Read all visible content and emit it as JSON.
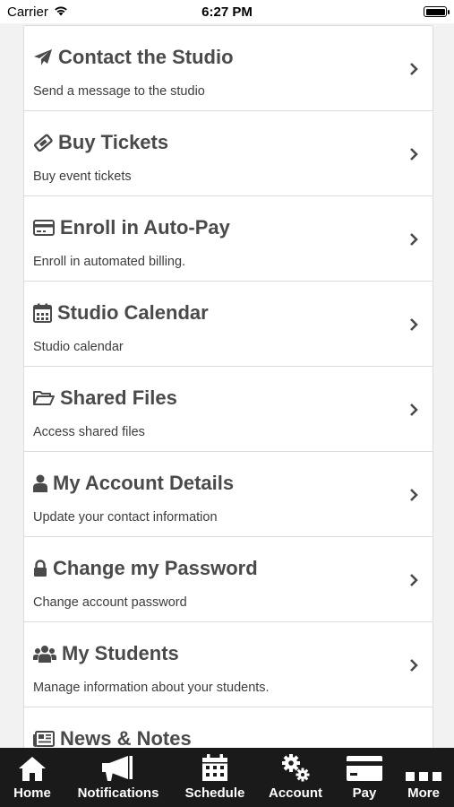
{
  "status": {
    "carrier": "Carrier",
    "time": "6:27 PM"
  },
  "menu": [
    {
      "title": "Contact the Studio",
      "subtitle": "Send a message to the studio",
      "icon": "paper-plane-icon"
    },
    {
      "title": "Buy Tickets",
      "subtitle": "Buy event tickets",
      "icon": "ticket-icon"
    },
    {
      "title": "Enroll in Auto-Pay",
      "subtitle": "Enroll in automated billing.",
      "icon": "credit-card-icon"
    },
    {
      "title": "Studio Calendar",
      "subtitle": "Studio calendar",
      "icon": "calendar-icon"
    },
    {
      "title": "Shared Files",
      "subtitle": "Access shared files",
      "icon": "folder-open-icon"
    },
    {
      "title": "My Account Details",
      "subtitle": "Update your contact information",
      "icon": "user-icon"
    },
    {
      "title": "Change my Password",
      "subtitle": "Change account password",
      "icon": "lock-icon"
    },
    {
      "title": "My Students",
      "subtitle": "Manage information about your students.",
      "icon": "users-icon"
    },
    {
      "title": "News & Notes",
      "subtitle": "",
      "icon": "newspaper-icon"
    }
  ],
  "tabs": [
    {
      "label": "Home",
      "icon": "home-icon"
    },
    {
      "label": "Notifications",
      "icon": "megaphone-icon"
    },
    {
      "label": "Schedule",
      "icon": "calendar-icon"
    },
    {
      "label": "Account",
      "icon": "gears-icon"
    },
    {
      "label": "Pay",
      "icon": "credit-card-icon"
    },
    {
      "label": "More",
      "icon": "more-icon"
    }
  ],
  "colors": {
    "tabbar_bg": "#1a1a1a",
    "text": "#4a4a4a",
    "divider": "#dcdcdc"
  }
}
